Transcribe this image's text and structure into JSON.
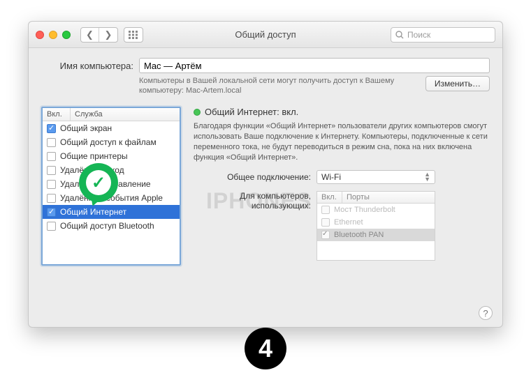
{
  "window": {
    "title": "Общий доступ",
    "search_placeholder": "Поиск"
  },
  "computer": {
    "label": "Имя компьютера:",
    "value": "Mac — Артём",
    "description": "Компьютеры в Вашей локальной сети могут получить доступ к Вашему компьютеру: Mac-Artem.local",
    "change_button": "Изменить…"
  },
  "services": {
    "header_on": "Вкл.",
    "header_name": "Служба",
    "items": [
      {
        "label": "Общий экран",
        "checked": true,
        "selected": false
      },
      {
        "label": "Общий доступ к файлам",
        "checked": false,
        "selected": false
      },
      {
        "label": "Общие принтеры",
        "checked": false,
        "selected": false
      },
      {
        "label": "Удалённый вход",
        "checked": false,
        "selected": false
      },
      {
        "label": "Удалённое управление",
        "checked": false,
        "selected": false
      },
      {
        "label": "Удалённые события Apple",
        "checked": false,
        "selected": false
      },
      {
        "label": "Общий Интернет",
        "checked": true,
        "selected": true
      },
      {
        "label": "Общий доступ Bluetooth",
        "checked": false,
        "selected": false
      }
    ]
  },
  "detail": {
    "status_label": "Общий Интернет: вкл.",
    "description": "Благодаря функции «Общий Интернет» пользователи других компьютеров смогут использовать Ваше подключение к Интернету. Компьютеры, подключенные к сети переменного тока, не будут переводиться в режим сна, пока на них включена функция «Общий Интернет».",
    "share_from_label": "Общее подключение:",
    "share_from_value": "Wi-Fi",
    "to_label_line1": "Для компьютеров,",
    "to_label_line2": "использующих:",
    "ports_header_on": "Вкл.",
    "ports_header_name": "Порты",
    "ports": [
      {
        "label": "Мост Thunderbolt",
        "checked": false,
        "selected": false,
        "dim": true
      },
      {
        "label": "Ethernet",
        "checked": false,
        "selected": false,
        "dim": true
      },
      {
        "label": "Bluetooth PAN",
        "checked": true,
        "selected": true,
        "dim": false
      }
    ]
  },
  "overlay": {
    "watermark": "IPHONES",
    "step": "4"
  }
}
